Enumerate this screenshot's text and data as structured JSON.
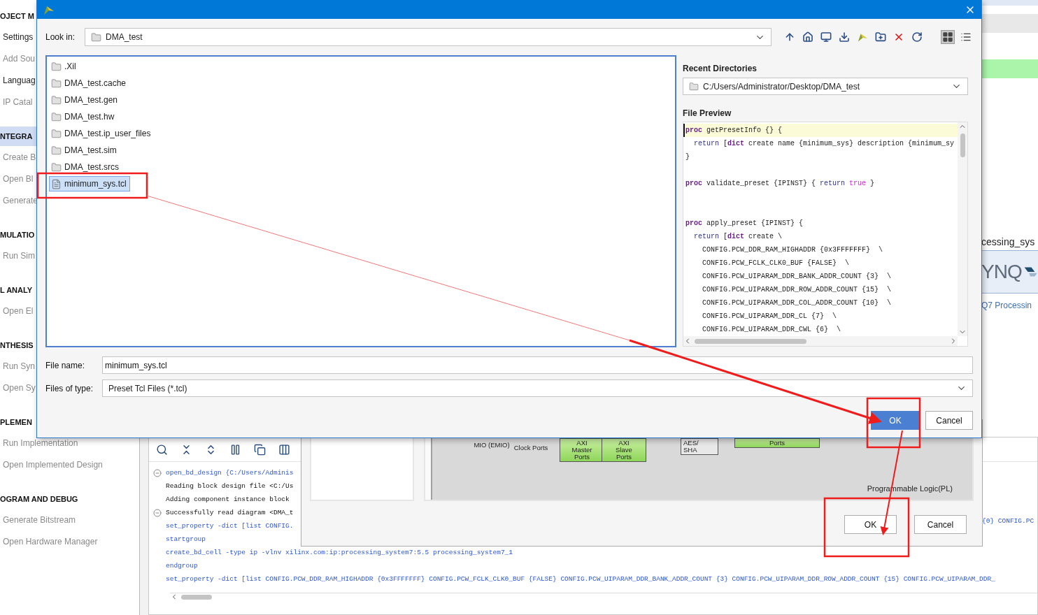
{
  "nav": [
    {
      "kind": "header",
      "label": "OJECT M",
      "selected": false
    },
    {
      "kind": "item",
      "label": "Settings",
      "disabled": false
    },
    {
      "kind": "item",
      "label": "Add Sou",
      "disabled": true
    },
    {
      "kind": "item",
      "label": "Languag",
      "disabled": false
    },
    {
      "kind": "item",
      "label": "IP Catal",
      "disabled": true
    },
    {
      "kind": "header",
      "label": "NTEGRA",
      "selected": true
    },
    {
      "kind": "item",
      "label": "Create B",
      "disabled": true
    },
    {
      "kind": "item",
      "label": "Open Bl",
      "disabled": true
    },
    {
      "kind": "item",
      "label": "Generate",
      "disabled": true
    },
    {
      "kind": "header",
      "label": "MULATIO",
      "selected": false
    },
    {
      "kind": "item",
      "label": "Run Sim",
      "disabled": true
    },
    {
      "kind": "header",
      "label": "L ANALY",
      "selected": false
    },
    {
      "kind": "item",
      "label": "Open El",
      "disabled": true
    },
    {
      "kind": "header",
      "label": "NTHESIS",
      "selected": false
    },
    {
      "kind": "item",
      "label": "Run Syn",
      "disabled": true
    },
    {
      "kind": "item",
      "label": "Open Sy",
      "disabled": true
    },
    {
      "kind": "header",
      "label": "PLEMEN",
      "selected": false
    },
    {
      "kind": "item",
      "label": "Run Implementation",
      "disabled": true
    },
    {
      "kind": "item",
      "label": "Open Implemented Design",
      "disabled": true
    },
    {
      "kind": "header",
      "label": "OGRAM AND DEBUG",
      "selected": false
    },
    {
      "kind": "item",
      "label": "Generate Bitstream",
      "disabled": true
    },
    {
      "kind": "item",
      "label": "Open Hardware Manager",
      "disabled": true
    }
  ],
  "right_panel": {
    "title": "cessing_sys",
    "logo": "YNQ",
    "caption": "Q7 Processin"
  },
  "console": {
    "lines": [
      {
        "kind": "command",
        "fold": true,
        "text": "open_bd_design {C:/Users/Adminis"
      },
      {
        "kind": "output",
        "fold": false,
        "text": "Reading block design file <C:/Us"
      },
      {
        "kind": "output",
        "fold": false,
        "text": "Adding component instance block"
      },
      {
        "kind": "output",
        "fold": true,
        "text": "Successfully read diagram <DMA_t"
      },
      {
        "kind": "command",
        "fold": false,
        "text": "set_property -dict [list CONFIG."
      },
      {
        "kind": "command",
        "fold": false,
        "text": "startgroup"
      },
      {
        "kind": "command",
        "fold": false,
        "text": "create_bd_cell -type ip -vlnv xilinx.com:ip:processing_system7:5.5 processing_system7_1"
      },
      {
        "kind": "command",
        "fold": false,
        "text": "endgroup"
      },
      {
        "kind": "command",
        "fold": false,
        "text": "set_property -dict [list CONFIG.PCW_DDR_RAM_HIGHADDR {0x3FFFFFFF} CONFIG.PCW_FCLK_CLK0_BUF {FALSE} CONFIG.PCW_UIPARAM_DDR_BANK_ADDR_COUNT {3} CONFIG.PCW_UIPARAM_DDR_ROW_ADDR_COUNT {15} CONFIG.PCW_UIPARAM_DDR_"
      }
    ],
    "overflow_text": "{0} CONFIG.PC"
  },
  "ip_dialog": {
    "blocks": [
      {
        "kind": "label",
        "lines": [
          "MIO (EMIO)"
        ]
      },
      {
        "kind": "label",
        "lines": [
          "Clock Ports"
        ]
      },
      {
        "kind": "port",
        "lines": [
          "AXI",
          "Master",
          "Ports"
        ]
      },
      {
        "kind": "port",
        "lines": [
          "AXI",
          "Slave",
          "Ports"
        ]
      },
      {
        "kind": "unit",
        "lines": [
          "AES/",
          "SHA"
        ]
      },
      {
        "kind": "port",
        "lines": [
          "Ports"
        ]
      }
    ],
    "region_label": "Programmable Logic(PL)",
    "buttons": [
      {
        "label": "OK"
      },
      {
        "label": "Cancel"
      }
    ]
  },
  "file_dialog": {
    "look_in_label": "Look in:",
    "look_in": "DMA_test",
    "files": [
      {
        "kind": "folder",
        "name": ".Xil",
        "selected": false
      },
      {
        "kind": "folder",
        "name": "DMA_test.cache",
        "selected": false
      },
      {
        "kind": "folder",
        "name": "DMA_test.gen",
        "selected": false
      },
      {
        "kind": "folder",
        "name": "DMA_test.hw",
        "selected": false
      },
      {
        "kind": "folder",
        "name": "DMA_test.ip_user_files",
        "selected": false
      },
      {
        "kind": "folder",
        "name": "DMA_test.sim",
        "selected": false
      },
      {
        "kind": "folder",
        "name": "DMA_test.srcs",
        "selected": false
      },
      {
        "kind": "file",
        "name": "minimum_sys.tcl",
        "selected": true
      }
    ],
    "recent_label": "Recent Directories",
    "recent": "C:/Users/Administrator/Desktop/DMA_test",
    "preview_label": "File Preview",
    "preview": [
      {
        "kind": "code",
        "current": true,
        "segments": [
          {
            "kind": "keyword",
            "text": "proc"
          },
          {
            "kind": "plain",
            "text": " getPresetInfo {} {"
          }
        ]
      },
      {
        "kind": "code",
        "current": false,
        "segments": [
          {
            "kind": "command",
            "text": "  return"
          },
          {
            "kind": "plain",
            "text": " ["
          },
          {
            "kind": "keyword",
            "text": "dict"
          },
          {
            "kind": "plain",
            "text": " create name {minimum_sys} description {minimum_sy"
          }
        ]
      },
      {
        "kind": "code",
        "current": false,
        "segments": [
          {
            "kind": "plain",
            "text": "}"
          }
        ]
      },
      {
        "kind": "blank",
        "current": false
      },
      {
        "kind": "code",
        "current": false,
        "segments": [
          {
            "kind": "keyword",
            "text": "proc"
          },
          {
            "kind": "plain",
            "text": " validate_preset {IPINST} { "
          },
          {
            "kind": "command",
            "text": "return"
          },
          {
            "kind": "value",
            "text": " true"
          },
          {
            "kind": "plain",
            "text": " }"
          }
        ]
      },
      {
        "kind": "blank",
        "current": false
      },
      {
        "kind": "blank",
        "current": false
      },
      {
        "kind": "code",
        "current": false,
        "segments": [
          {
            "kind": "keyword",
            "text": "proc"
          },
          {
            "kind": "plain",
            "text": " apply_preset {IPINST} {"
          }
        ]
      },
      {
        "kind": "code",
        "current": false,
        "segments": [
          {
            "kind": "command",
            "text": "  return"
          },
          {
            "kind": "plain",
            "text": " ["
          },
          {
            "kind": "keyword",
            "text": "dict"
          },
          {
            "kind": "plain",
            "text": " create \\"
          }
        ]
      },
      {
        "kind": "code",
        "current": false,
        "segments": [
          {
            "kind": "plain",
            "text": "    CONFIG.PCW_DDR_RAM_HIGHADDR {0x3FFFFFFF}  \\"
          }
        ]
      },
      {
        "kind": "code",
        "current": false,
        "segments": [
          {
            "kind": "plain",
            "text": "    CONFIG.PCW_FCLK_CLK0_BUF {FALSE}  \\"
          }
        ]
      },
      {
        "kind": "code",
        "current": false,
        "segments": [
          {
            "kind": "plain",
            "text": "    CONFIG.PCW_UIPARAM_DDR_BANK_ADDR_COUNT {3}  \\"
          }
        ]
      },
      {
        "kind": "code",
        "current": false,
        "segments": [
          {
            "kind": "plain",
            "text": "    CONFIG.PCW_UIPARAM_DDR_ROW_ADDR_COUNT {15}  \\"
          }
        ]
      },
      {
        "kind": "code",
        "current": false,
        "segments": [
          {
            "kind": "plain",
            "text": "    CONFIG.PCW_UIPARAM_DDR_COL_ADDR_COUNT {10}  \\"
          }
        ]
      },
      {
        "kind": "code",
        "current": false,
        "segments": [
          {
            "kind": "plain",
            "text": "    CONFIG.PCW_UIPARAM_DDR_CL {7}  \\"
          }
        ]
      },
      {
        "kind": "code",
        "current": false,
        "segments": [
          {
            "kind": "plain",
            "text": "    CONFIG.PCW_UIPARAM_DDR_CWL {6}  \\"
          }
        ]
      }
    ],
    "file_name_label": "File name:",
    "file_name": "minimum_sys.tcl",
    "type_label": "Files of type:",
    "type": "Preset Tcl Files (*.tcl)",
    "buttons": [
      {
        "label": "OK",
        "primary": true
      },
      {
        "label": "Cancel",
        "primary": false
      }
    ]
  }
}
